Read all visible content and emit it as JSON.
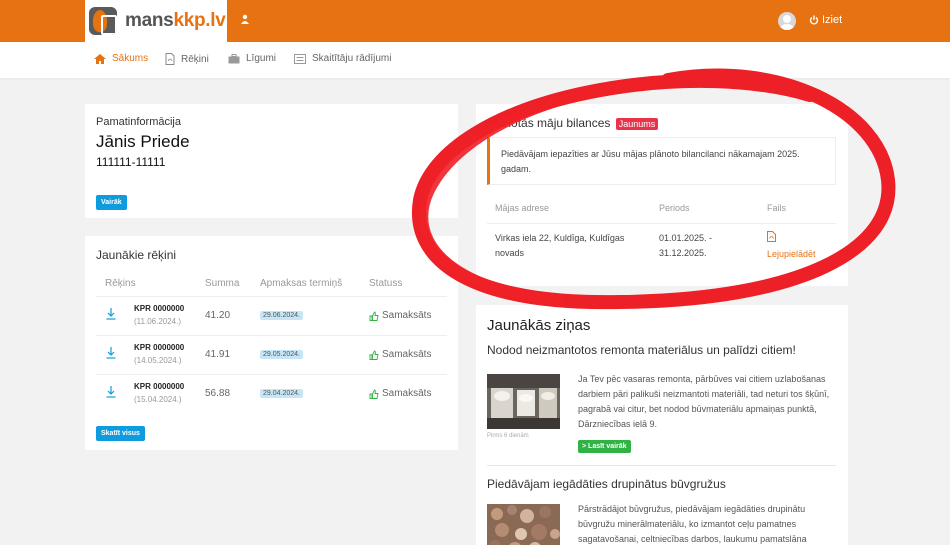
{
  "header": {
    "logo": {
      "brand_main": "mans",
      "brand_accent": "kkp.lv"
    },
    "logout_label": "Iziet",
    "colors": {
      "primary": "#e67211",
      "accent_blue": "#0f9cde",
      "accent_green": "#2fb344",
      "badge_red": "#e8334a"
    }
  },
  "nav": {
    "items": [
      {
        "label": "Sākums",
        "icon": "home-icon",
        "active": true
      },
      {
        "label": "Rēķini",
        "icon": "pdf-file-icon",
        "active": false
      },
      {
        "label": "Līgumi",
        "icon": "briefcase-icon",
        "active": false
      },
      {
        "label": "Skaitītāju rādījumi",
        "icon": "meter-icon",
        "active": false
      }
    ]
  },
  "basic_info": {
    "title": "Pamatinformācija",
    "name": "Jānis Priede",
    "account": "111111-11111",
    "more_button": "Vairāk"
  },
  "bills": {
    "title": "Jaunākie rēķini",
    "columns": [
      "Rēķins",
      "Summa",
      "Apmaksas termiņš",
      "Statuss"
    ],
    "rows": [
      {
        "number": "KPR 0000000",
        "date": "(11.06.2024.)",
        "sum": "41.20",
        "due": "29.06.2024.",
        "status": "Samaksāts"
      },
      {
        "number": "KPR 0000000",
        "date": "(14.05.2024.)",
        "sum": "41.91",
        "due": "29.05.2024.",
        "status": "Samaksāts"
      },
      {
        "number": "KPR 0000000",
        "date": "(15.04.2024.)",
        "sum": "56.88",
        "due": "29.04.2024.",
        "status": "Samaksāts"
      }
    ],
    "view_all_button": "Skatīt visus"
  },
  "balance": {
    "title": "Plānotās māju bilances",
    "badge": "Jaunums",
    "notice": "Piedāvājam iepazīties ar Jūsu mājas plānoto bilancilanci nākamajam 2025. gadam.",
    "columns": [
      "Mājas adrese",
      "Periods",
      "Fails"
    ],
    "row": {
      "address": "Virkas iela 22, Kuldīga, Kuldīgas novads",
      "period": "01.01.2025. - 31.12.2025.",
      "file_link": "Lejupielādēt"
    }
  },
  "news": {
    "heading": "Jaunākās ziņas",
    "items": [
      {
        "title": "Nodod neizmantotos remonta materiālus un palīdzi citiem!",
        "body": "Ja Tev pēc vasaras remonta, pārbūves vai citiem uzlabošanas darbiem pāri palikuši neizmantoti materiāli, tad neturi tos šķūnī, pagrabā vai citur, bet nodod būvmateriālu apmaiņas punktā, Dārzniecības ielā 9.",
        "image_caption": "Pirms 6 dienām",
        "read_more": "Lasīt vairāk"
      },
      {
        "title": "Piedāvājam iegādāties drupinātus būvgružus",
        "body": "Pārstrādājot būvgružus, piedāvājam iegādāties drupinātu būvgružu minerālmateriālu, ko izmantot ceļu pamatnes sagatavošanai, celtniecības darbos, laukumu pamatslāna"
      }
    ]
  }
}
